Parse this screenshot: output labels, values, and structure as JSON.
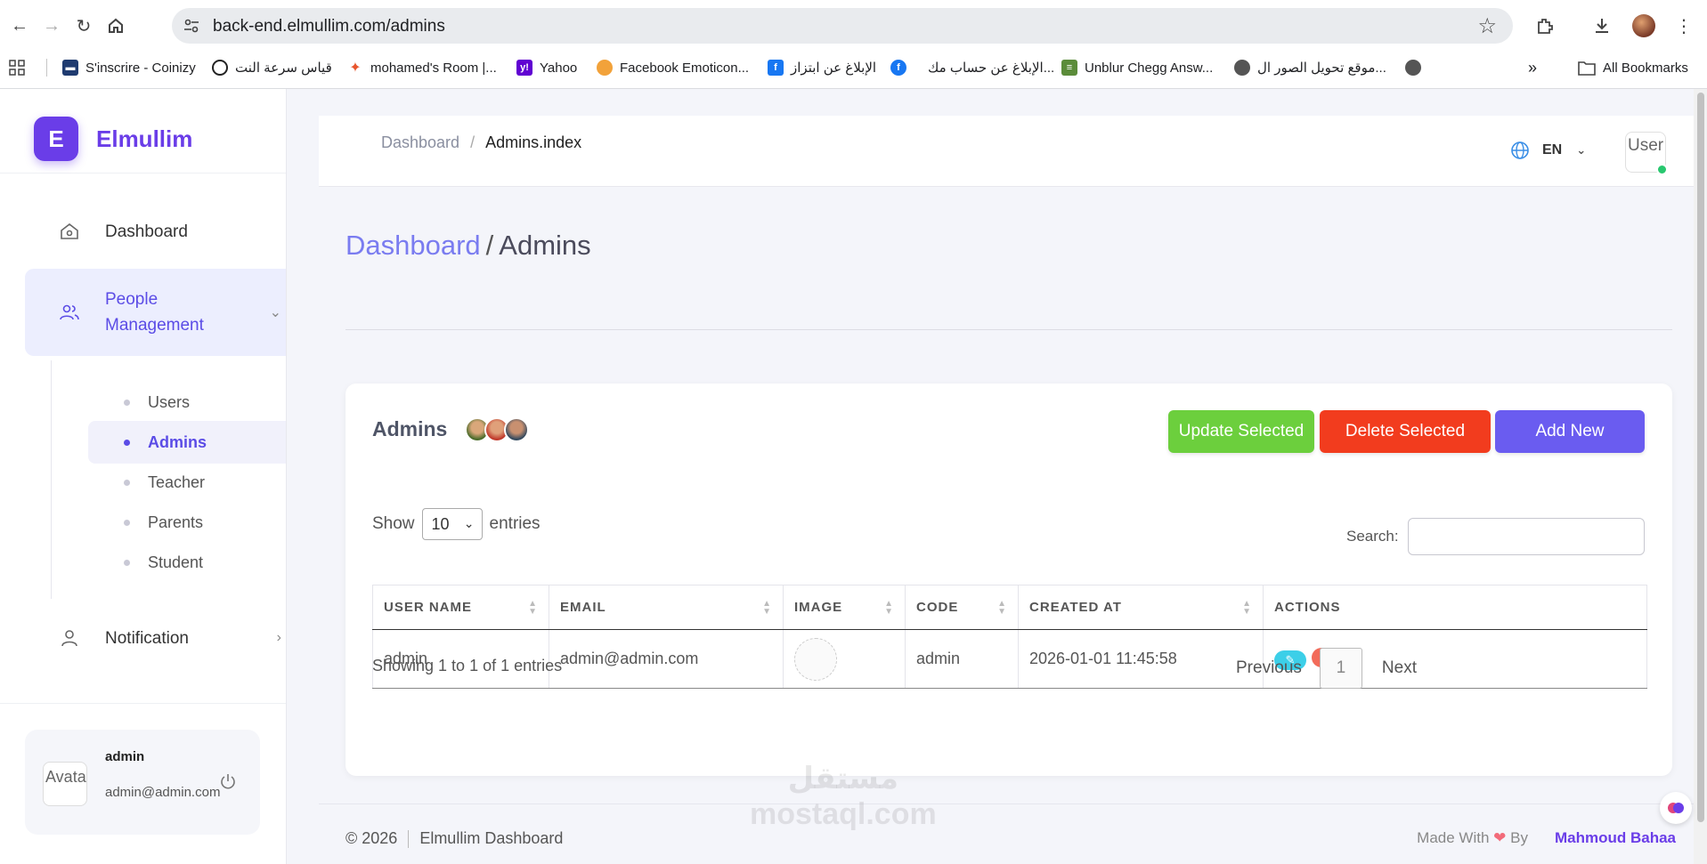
{
  "browser": {
    "url": "back-end.elmullim.com/admins",
    "bookmarks": [
      {
        "label": "S'inscrire - Coinizy",
        "icon": "coinizy-icon",
        "color": "#1f3b70"
      },
      {
        "label": "قياس سرعة النت",
        "icon": "speedtest-icon",
        "color": "#222222"
      },
      {
        "label": "mohamed's Room |...",
        "icon": "room-icon",
        "color": "#e8552d"
      },
      {
        "label": "Yahoo",
        "icon": "yahoo-icon",
        "color": "#6001d2"
      },
      {
        "label": "Facebook Emoticon...",
        "icon": "emoticon-icon",
        "color": "#f2a23a"
      },
      {
        "label": "الإبلاغ عن ابتزاز",
        "icon": "facebook-icon",
        "color": "#1877f2"
      },
      {
        "label": "الإبلاغ عن حساب مك...",
        "icon": "facebook-icon",
        "color": "#1877f2"
      },
      {
        "label": "Unblur Chegg Answ...",
        "icon": "books-icon",
        "color": "#5b8c3a"
      },
      {
        "label": "موقع تحويل الصور ال...",
        "icon": "globe-icon",
        "color": "#555555"
      }
    ],
    "all_bookmarks": "All Bookmarks"
  },
  "sidebar": {
    "brand_letter": "E",
    "brand_name": "Elmullim",
    "menu": {
      "dashboard": "Dashboard",
      "people_management": "People Management",
      "notification": "Notification"
    },
    "submenu": [
      "Users",
      "Admins",
      "Teacher",
      "Parents",
      "Student"
    ],
    "user": {
      "avatar_alt": "Avatar",
      "name": "admin",
      "email": "admin@admin.com"
    }
  },
  "topbar": {
    "crumb_root": "Dashboard",
    "crumb_sep": "/",
    "crumb_current": "Admins.index",
    "lang": "EN",
    "avatar_alt": "User"
  },
  "page": {
    "title_link": "Dashboard",
    "title_sep": "/",
    "title": "Admins"
  },
  "card": {
    "title": "Admins",
    "buttons": {
      "update": "Update Selected",
      "delete": "Delete Selected",
      "add": "Add New"
    },
    "show_label": "Show",
    "entries_value": "10",
    "entries_label": "entries",
    "search_label": "Search:",
    "columns": [
      "USER NAME",
      "EMAIL",
      "IMAGE",
      "CODE",
      "CREATED AT",
      "ACTIONS"
    ],
    "rows": [
      {
        "username": "admin",
        "email": "admin@admin.com",
        "code": "admin",
        "created_at": "2026-01-01 11:45:58"
      }
    ],
    "info": "Showing 1 to 1 of 1 entries",
    "pager": {
      "prev": "Previous",
      "page": "1",
      "next": "Next"
    }
  },
  "footer": {
    "copyright": "© 2026",
    "app_name": "Elmullim Dashboard",
    "made_with": "Made With",
    "heart": "❤",
    "by": "By",
    "author": "Mahmoud Bahaa"
  },
  "colors": {
    "brand": "#6a3de8",
    "update": "#6ccf3d",
    "delete": "#f23c1e",
    "add": "#6a5cf0"
  }
}
